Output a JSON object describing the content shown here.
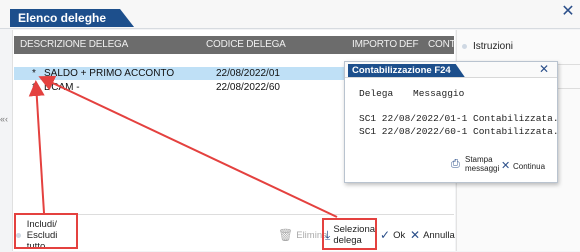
{
  "window": {
    "title": "Elenco deleghe",
    "close_glyph": "✕"
  },
  "table": {
    "headers": [
      "DESCRIZIONE DELEGA",
      "CODICE DELEGA",
      "IMPORTO",
      "DEF",
      "CONT"
    ],
    "rows": [
      {
        "marker": "*",
        "description": "SALDO + PRIMO ACCONTO",
        "code": "22/08/2022/01",
        "selected": true
      },
      {
        "marker": "*",
        "description": "DCAM -",
        "code": "22/08/2022/60",
        "selected": false
      }
    ]
  },
  "side_panel": {
    "items": [
      "Istruzioni"
    ]
  },
  "left_marker": "«‹",
  "dialog": {
    "title": "Contabilizzazione F24",
    "close_glyph": "✕",
    "col_delega": "Delega",
    "col_messaggio": "Messaggio",
    "lines": [
      "SC1 22/08/2022/01-1 Contabilizzata.",
      "SC1 22/08/2022/60-1 Contabilizzata."
    ],
    "print_label_1": "Stampa",
    "print_label_2": "messaggi",
    "continue_label": "Continua"
  },
  "toolbar": {
    "include_line1": "Includi/",
    "include_line2": "Escludi tutto",
    "delete_label": "Elimina",
    "select_line1": "Seleziona",
    "select_line2": "delega",
    "ok_label": "Ok",
    "cancel_label": "Annulla"
  },
  "colors": {
    "title_blue": "#1d4f8c",
    "selected_row": "#bfe0f6",
    "header_gray": "#6c6c6c",
    "annotation_red": "#e4413f"
  }
}
